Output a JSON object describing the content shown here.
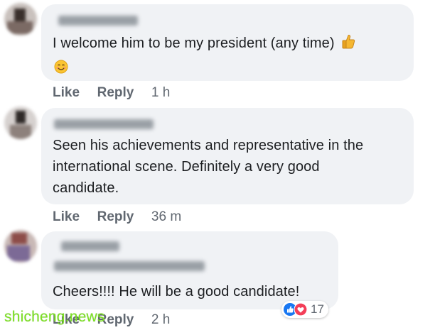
{
  "comments": [
    {
      "text_line1": "I welcome him to be my president (any time)",
      "like_label": "Like",
      "reply_label": "Reply",
      "timestamp": "1 h"
    },
    {
      "text_line1": "Seen his achievements and representative in the",
      "text_line2": "international scene. Definitely a very good",
      "text_line3": "candidate.",
      "like_label": "Like",
      "reply_label": "Reply",
      "timestamp": "36 m"
    },
    {
      "text_line1": "Cheers!!!! He will be a good candidate!",
      "like_label": "Like",
      "reply_label": "Reply",
      "timestamp": "2 h",
      "reaction_count": "17"
    }
  ],
  "watermark": "shicheng.news",
  "colors": {
    "bubble": "#f0f2f5",
    "text": "#1c1e21",
    "meta": "#606770",
    "like_blue": "#1877f2",
    "love_red": "#f33e58",
    "watermark": "#7be022"
  },
  "icons": [
    "thumbs-up-emoji-icon",
    "smiling-face-emoji-icon",
    "like-reaction-icon",
    "love-reaction-icon"
  ]
}
